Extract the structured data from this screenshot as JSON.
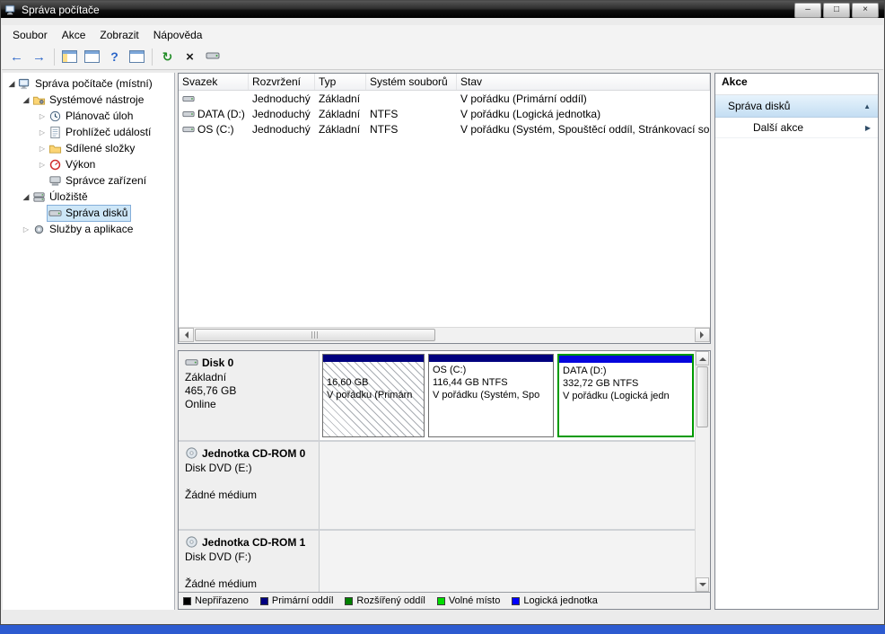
{
  "window": {
    "title": "Správa počítače"
  },
  "icons": {
    "minimize": "–",
    "maximize": "□",
    "close": "×",
    "expanded": "◢",
    "collapsed": "▷",
    "back": "←",
    "forward": "→",
    "help": "?",
    "refresh": "↻",
    "delete": "×",
    "action_collapse": "▲",
    "action_more": "▶"
  },
  "menu": {
    "items": [
      {
        "label": "Soubor"
      },
      {
        "label": "Akce"
      },
      {
        "label": "Zobrazit"
      },
      {
        "label": "Nápověda"
      }
    ]
  },
  "tree": {
    "items": [
      {
        "label": "Správa počítače (místní)",
        "state": "expanded"
      },
      {
        "label": "Systémové nástroje",
        "state": "expanded"
      },
      {
        "label": "Plánovač úloh",
        "state": "collapsed"
      },
      {
        "label": "Prohlížeč událostí",
        "state": "collapsed"
      },
      {
        "label": "Sdílené složky",
        "state": "collapsed"
      },
      {
        "label": "Výkon",
        "state": "collapsed"
      },
      {
        "label": "Správce zařízení",
        "state": "leaf"
      },
      {
        "label": "Úložiště",
        "state": "expanded"
      },
      {
        "label": "Správa disků",
        "state": "leaf",
        "selected": true
      },
      {
        "label": "Služby a aplikace",
        "state": "collapsed"
      }
    ]
  },
  "volume_list": {
    "columns": [
      {
        "label": "Svazek"
      },
      {
        "label": "Rozvržení"
      },
      {
        "label": "Typ"
      },
      {
        "label": "Systém souborů"
      },
      {
        "label": "Stav"
      }
    ],
    "rows": [
      {
        "svazek": "",
        "rozvrzeni": "Jednoduchý",
        "typ": "Základní",
        "system_souboru": "",
        "stav": "V pořádku (Primární oddíl)"
      },
      {
        "svazek": "DATA (D:)",
        "rozvrzeni": "Jednoduchý",
        "typ": "Základní",
        "system_souboru": "NTFS",
        "stav": "V pořádku (Logická jednotka)"
      },
      {
        "svazek": "OS (C:)",
        "rozvrzeni": "Jednoduchý",
        "typ": "Základní",
        "system_souboru": "NTFS",
        "stav": "V pořádku (Systém, Spouštěcí oddíl, Stránkovací soub"
      }
    ]
  },
  "disks": [
    {
      "name": "Disk 0",
      "type": "Základní",
      "size": "465,76 GB",
      "status": "Online",
      "partitions": [
        {
          "name": "",
          "size": "16,60 GB",
          "status": "V pořádku (Primárn"
        },
        {
          "name": "OS (C:)",
          "size": "116,44 GB NTFS",
          "status": "V pořádku (Systém, Spo"
        },
        {
          "name": "DATA (D:)",
          "size": "332,72 GB NTFS",
          "status": "V pořádku (Logická jedn"
        }
      ]
    },
    {
      "name": "Jednotka CD-ROM 0",
      "type": "Disk DVD (E:)",
      "status": "Žádné médium"
    },
    {
      "name": "Jednotka CD-ROM 1",
      "type": "Disk DVD (F:)",
      "status": "Žádné médium"
    }
  ],
  "legend": {
    "items": [
      {
        "label": "Nepřiřazeno",
        "color": "#000000"
      },
      {
        "label": "Primární oddíl",
        "color": "#000080"
      },
      {
        "label": "Rozšířený oddíl",
        "color": "#008000"
      },
      {
        "label": "Volné místo",
        "color": "#00dd00"
      },
      {
        "label": "Logická jednotka",
        "color": "#0000ff"
      }
    ]
  },
  "actions": {
    "title": "Akce",
    "items": [
      {
        "label": "Správa disků"
      },
      {
        "label": "Další akce"
      }
    ]
  }
}
